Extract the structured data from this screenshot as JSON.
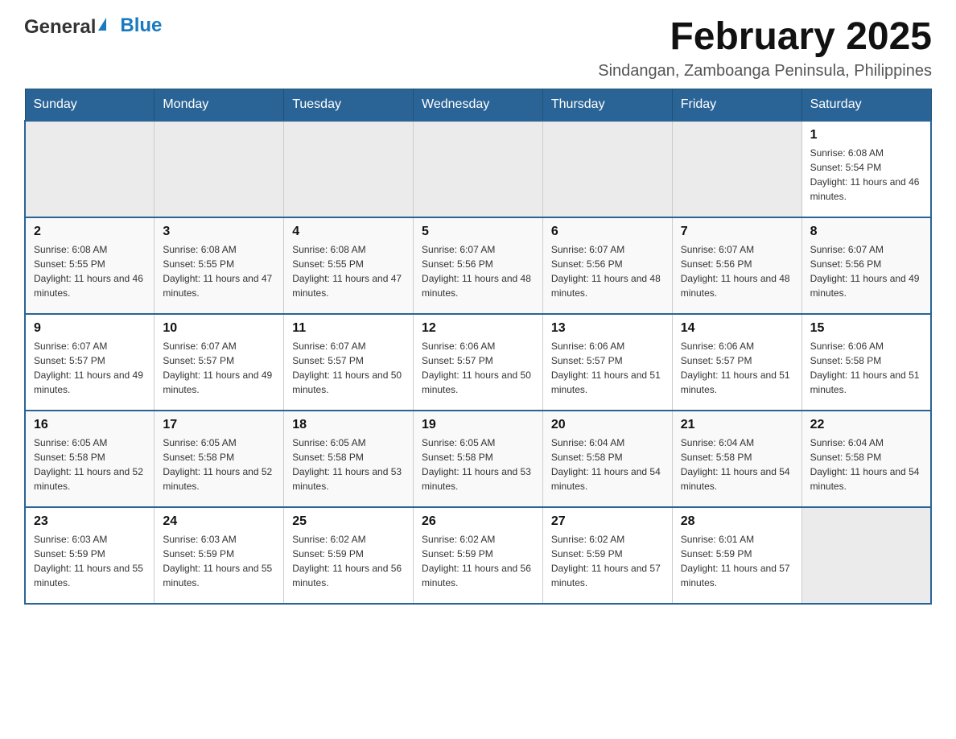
{
  "header": {
    "logo_general": "General",
    "logo_blue": "Blue",
    "month_title": "February 2025",
    "location": "Sindangan, Zamboanga Peninsula, Philippines"
  },
  "days_of_week": [
    "Sunday",
    "Monday",
    "Tuesday",
    "Wednesday",
    "Thursday",
    "Friday",
    "Saturday"
  ],
  "weeks": [
    {
      "days": [
        {
          "number": "",
          "info": ""
        },
        {
          "number": "",
          "info": ""
        },
        {
          "number": "",
          "info": ""
        },
        {
          "number": "",
          "info": ""
        },
        {
          "number": "",
          "info": ""
        },
        {
          "number": "",
          "info": ""
        },
        {
          "number": "1",
          "info": "Sunrise: 6:08 AM\nSunset: 5:54 PM\nDaylight: 11 hours and 46 minutes."
        }
      ]
    },
    {
      "days": [
        {
          "number": "2",
          "info": "Sunrise: 6:08 AM\nSunset: 5:55 PM\nDaylight: 11 hours and 46 minutes."
        },
        {
          "number": "3",
          "info": "Sunrise: 6:08 AM\nSunset: 5:55 PM\nDaylight: 11 hours and 47 minutes."
        },
        {
          "number": "4",
          "info": "Sunrise: 6:08 AM\nSunset: 5:55 PM\nDaylight: 11 hours and 47 minutes."
        },
        {
          "number": "5",
          "info": "Sunrise: 6:07 AM\nSunset: 5:56 PM\nDaylight: 11 hours and 48 minutes."
        },
        {
          "number": "6",
          "info": "Sunrise: 6:07 AM\nSunset: 5:56 PM\nDaylight: 11 hours and 48 minutes."
        },
        {
          "number": "7",
          "info": "Sunrise: 6:07 AM\nSunset: 5:56 PM\nDaylight: 11 hours and 48 minutes."
        },
        {
          "number": "8",
          "info": "Sunrise: 6:07 AM\nSunset: 5:56 PM\nDaylight: 11 hours and 49 minutes."
        }
      ]
    },
    {
      "days": [
        {
          "number": "9",
          "info": "Sunrise: 6:07 AM\nSunset: 5:57 PM\nDaylight: 11 hours and 49 minutes."
        },
        {
          "number": "10",
          "info": "Sunrise: 6:07 AM\nSunset: 5:57 PM\nDaylight: 11 hours and 49 minutes."
        },
        {
          "number": "11",
          "info": "Sunrise: 6:07 AM\nSunset: 5:57 PM\nDaylight: 11 hours and 50 minutes."
        },
        {
          "number": "12",
          "info": "Sunrise: 6:06 AM\nSunset: 5:57 PM\nDaylight: 11 hours and 50 minutes."
        },
        {
          "number": "13",
          "info": "Sunrise: 6:06 AM\nSunset: 5:57 PM\nDaylight: 11 hours and 51 minutes."
        },
        {
          "number": "14",
          "info": "Sunrise: 6:06 AM\nSunset: 5:57 PM\nDaylight: 11 hours and 51 minutes."
        },
        {
          "number": "15",
          "info": "Sunrise: 6:06 AM\nSunset: 5:58 PM\nDaylight: 11 hours and 51 minutes."
        }
      ]
    },
    {
      "days": [
        {
          "number": "16",
          "info": "Sunrise: 6:05 AM\nSunset: 5:58 PM\nDaylight: 11 hours and 52 minutes."
        },
        {
          "number": "17",
          "info": "Sunrise: 6:05 AM\nSunset: 5:58 PM\nDaylight: 11 hours and 52 minutes."
        },
        {
          "number": "18",
          "info": "Sunrise: 6:05 AM\nSunset: 5:58 PM\nDaylight: 11 hours and 53 minutes."
        },
        {
          "number": "19",
          "info": "Sunrise: 6:05 AM\nSunset: 5:58 PM\nDaylight: 11 hours and 53 minutes."
        },
        {
          "number": "20",
          "info": "Sunrise: 6:04 AM\nSunset: 5:58 PM\nDaylight: 11 hours and 54 minutes."
        },
        {
          "number": "21",
          "info": "Sunrise: 6:04 AM\nSunset: 5:58 PM\nDaylight: 11 hours and 54 minutes."
        },
        {
          "number": "22",
          "info": "Sunrise: 6:04 AM\nSunset: 5:58 PM\nDaylight: 11 hours and 54 minutes."
        }
      ]
    },
    {
      "days": [
        {
          "number": "23",
          "info": "Sunrise: 6:03 AM\nSunset: 5:59 PM\nDaylight: 11 hours and 55 minutes."
        },
        {
          "number": "24",
          "info": "Sunrise: 6:03 AM\nSunset: 5:59 PM\nDaylight: 11 hours and 55 minutes."
        },
        {
          "number": "25",
          "info": "Sunrise: 6:02 AM\nSunset: 5:59 PM\nDaylight: 11 hours and 56 minutes."
        },
        {
          "number": "26",
          "info": "Sunrise: 6:02 AM\nSunset: 5:59 PM\nDaylight: 11 hours and 56 minutes."
        },
        {
          "number": "27",
          "info": "Sunrise: 6:02 AM\nSunset: 5:59 PM\nDaylight: 11 hours and 57 minutes."
        },
        {
          "number": "28",
          "info": "Sunrise: 6:01 AM\nSunset: 5:59 PM\nDaylight: 11 hours and 57 minutes."
        },
        {
          "number": "",
          "info": ""
        }
      ]
    }
  ]
}
